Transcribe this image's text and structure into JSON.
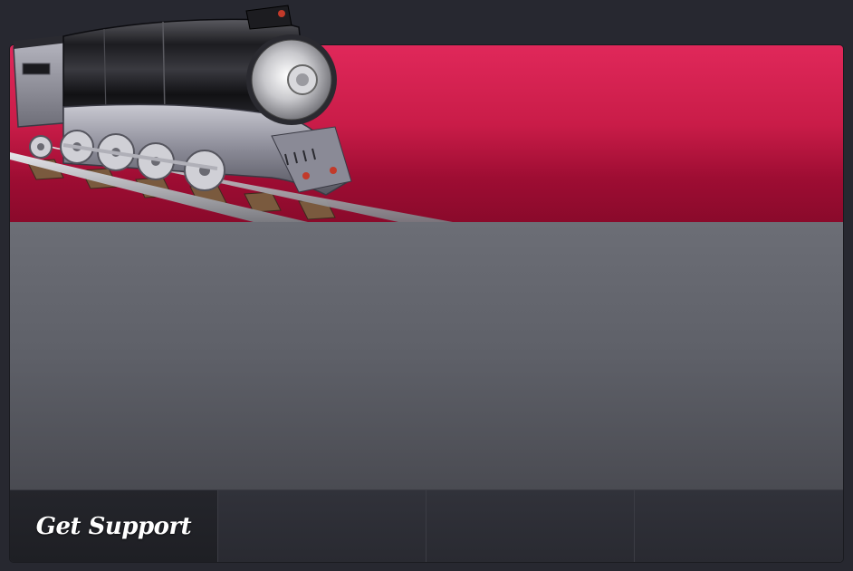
{
  "tabs": [
    {
      "label": "Get Support",
      "active": true
    },
    {
      "label": ""
    },
    {
      "label": ""
    },
    {
      "label": ""
    }
  ],
  "colors": {
    "page_background": "#272830",
    "banner_top": "#e0285a",
    "banner_bottom": "#8a0a2b",
    "content_top": "#6c6e76",
    "content_bottom": "#4a4b52",
    "tab_bar": "#2d2e36"
  },
  "illustration": {
    "name": "train-locomotive-icon"
  }
}
